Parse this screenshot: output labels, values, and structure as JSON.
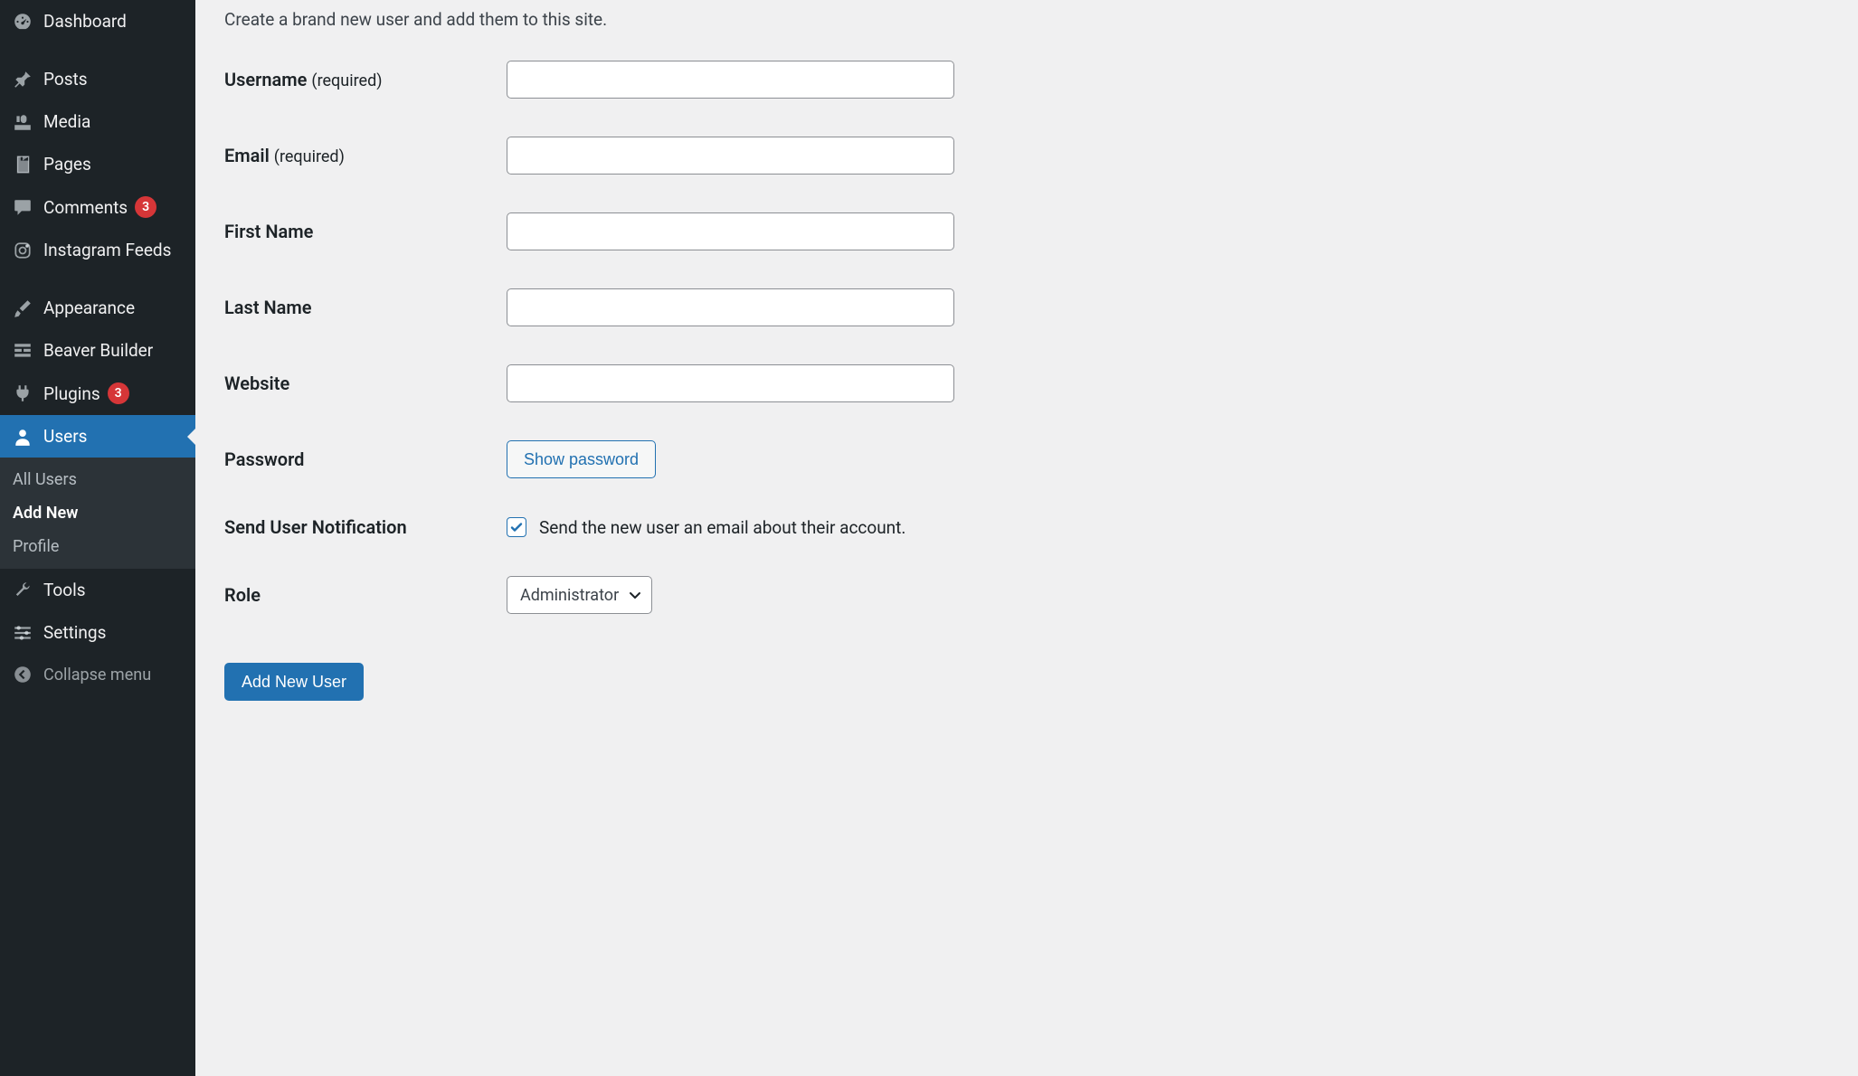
{
  "sidebar": {
    "items": [
      {
        "id": "dashboard",
        "label": "Dashboard",
        "icon": "gauge-icon"
      },
      {
        "separator": true
      },
      {
        "id": "posts",
        "label": "Posts",
        "icon": "pin-icon"
      },
      {
        "id": "media",
        "label": "Media",
        "icon": "media-icon"
      },
      {
        "id": "pages",
        "label": "Pages",
        "icon": "page-icon"
      },
      {
        "id": "comments",
        "label": "Comments",
        "icon": "comment-icon",
        "badge": "3"
      },
      {
        "id": "instagram",
        "label": "Instagram Feeds",
        "icon": "instagram-icon"
      },
      {
        "separator": true
      },
      {
        "id": "appearance",
        "label": "Appearance",
        "icon": "brush-icon"
      },
      {
        "id": "beaver",
        "label": "Beaver Builder",
        "icon": "grid-icon"
      },
      {
        "id": "plugins",
        "label": "Plugins",
        "icon": "plug-icon",
        "badge": "3"
      },
      {
        "id": "users",
        "label": "Users",
        "icon": "user-icon",
        "current": true
      },
      {
        "id": "tools",
        "label": "Tools",
        "icon": "wrench-icon"
      },
      {
        "id": "settings",
        "label": "Settings",
        "icon": "sliders-icon"
      }
    ],
    "submenu": {
      "items": [
        {
          "id": "all-users",
          "label": "All Users"
        },
        {
          "id": "add-new",
          "label": "Add New",
          "current": true
        },
        {
          "id": "profile",
          "label": "Profile"
        }
      ]
    },
    "collapse_label": "Collapse menu"
  },
  "form": {
    "intro": "Create a brand new user and add them to this site.",
    "required_suffix": "(required)",
    "fields": {
      "username_label": "Username",
      "email_label": "Email",
      "firstname_label": "First Name",
      "lastname_label": "Last Name",
      "website_label": "Website",
      "password_label": "Password",
      "show_password_button": "Show password",
      "send_notification_label": "Send User Notification",
      "send_notification_desc": "Send the new user an email about their account.",
      "send_notification_checked": true,
      "role_label": "Role",
      "role_value": "Administrator"
    },
    "submit_label": "Add New User"
  }
}
